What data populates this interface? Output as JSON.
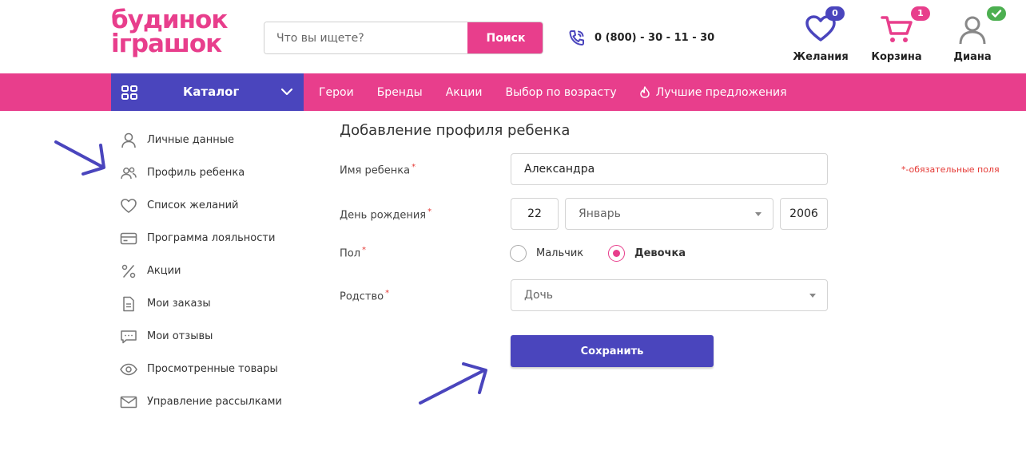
{
  "header": {
    "logo_line1": "будинок",
    "logo_line2": "іграшок",
    "search_placeholder": "Что вы ищете?",
    "search_button": "Поиск",
    "phone": "0 (800) - 30 - 11 - 30",
    "wishlist": {
      "label": "Желания",
      "count": "0"
    },
    "cart": {
      "label": "Корзина",
      "count": "1"
    },
    "user": {
      "label": "Диана"
    }
  },
  "nav": {
    "catalog": "Каталог",
    "items": [
      "Герои",
      "Бренды",
      "Акции",
      "Выбор по возрасту",
      "Лучшие предложения"
    ]
  },
  "sidebar": {
    "items": [
      {
        "label": "Личные данные",
        "icon": "user-icon"
      },
      {
        "label": "Профиль ребенка",
        "icon": "users-icon"
      },
      {
        "label": "Список желаний",
        "icon": "heart-icon"
      },
      {
        "label": "Программа лояльности",
        "icon": "card-icon"
      },
      {
        "label": "Акции",
        "icon": "percent-icon"
      },
      {
        "label": "Мои заказы",
        "icon": "document-icon"
      },
      {
        "label": "Мои отзывы",
        "icon": "chat-icon"
      },
      {
        "label": "Просмотренные товары",
        "icon": "eye-icon"
      },
      {
        "label": "Управление рассылками",
        "icon": "mail-icon"
      }
    ]
  },
  "form": {
    "title": "Добавление профиля ребенка",
    "required_note": "*-обязательные поля",
    "name_label": "Имя ребенка",
    "name_value": "Александра",
    "birthday_label": "День рождения",
    "birth_day": "22",
    "birth_month": "Январь",
    "birth_year": "2006",
    "gender_label": "Пол",
    "gender_boy": "Мальчик",
    "gender_girl": "Девочка",
    "gender_selected": "Девочка",
    "relation_label": "Родство",
    "relation_value": "Дочь",
    "save_button": "Сохранить"
  },
  "colors": {
    "brand_pink": "#e83e8c",
    "brand_blue": "#4a45bd",
    "required_red": "#e53935",
    "badge_green": "#4caf50"
  }
}
